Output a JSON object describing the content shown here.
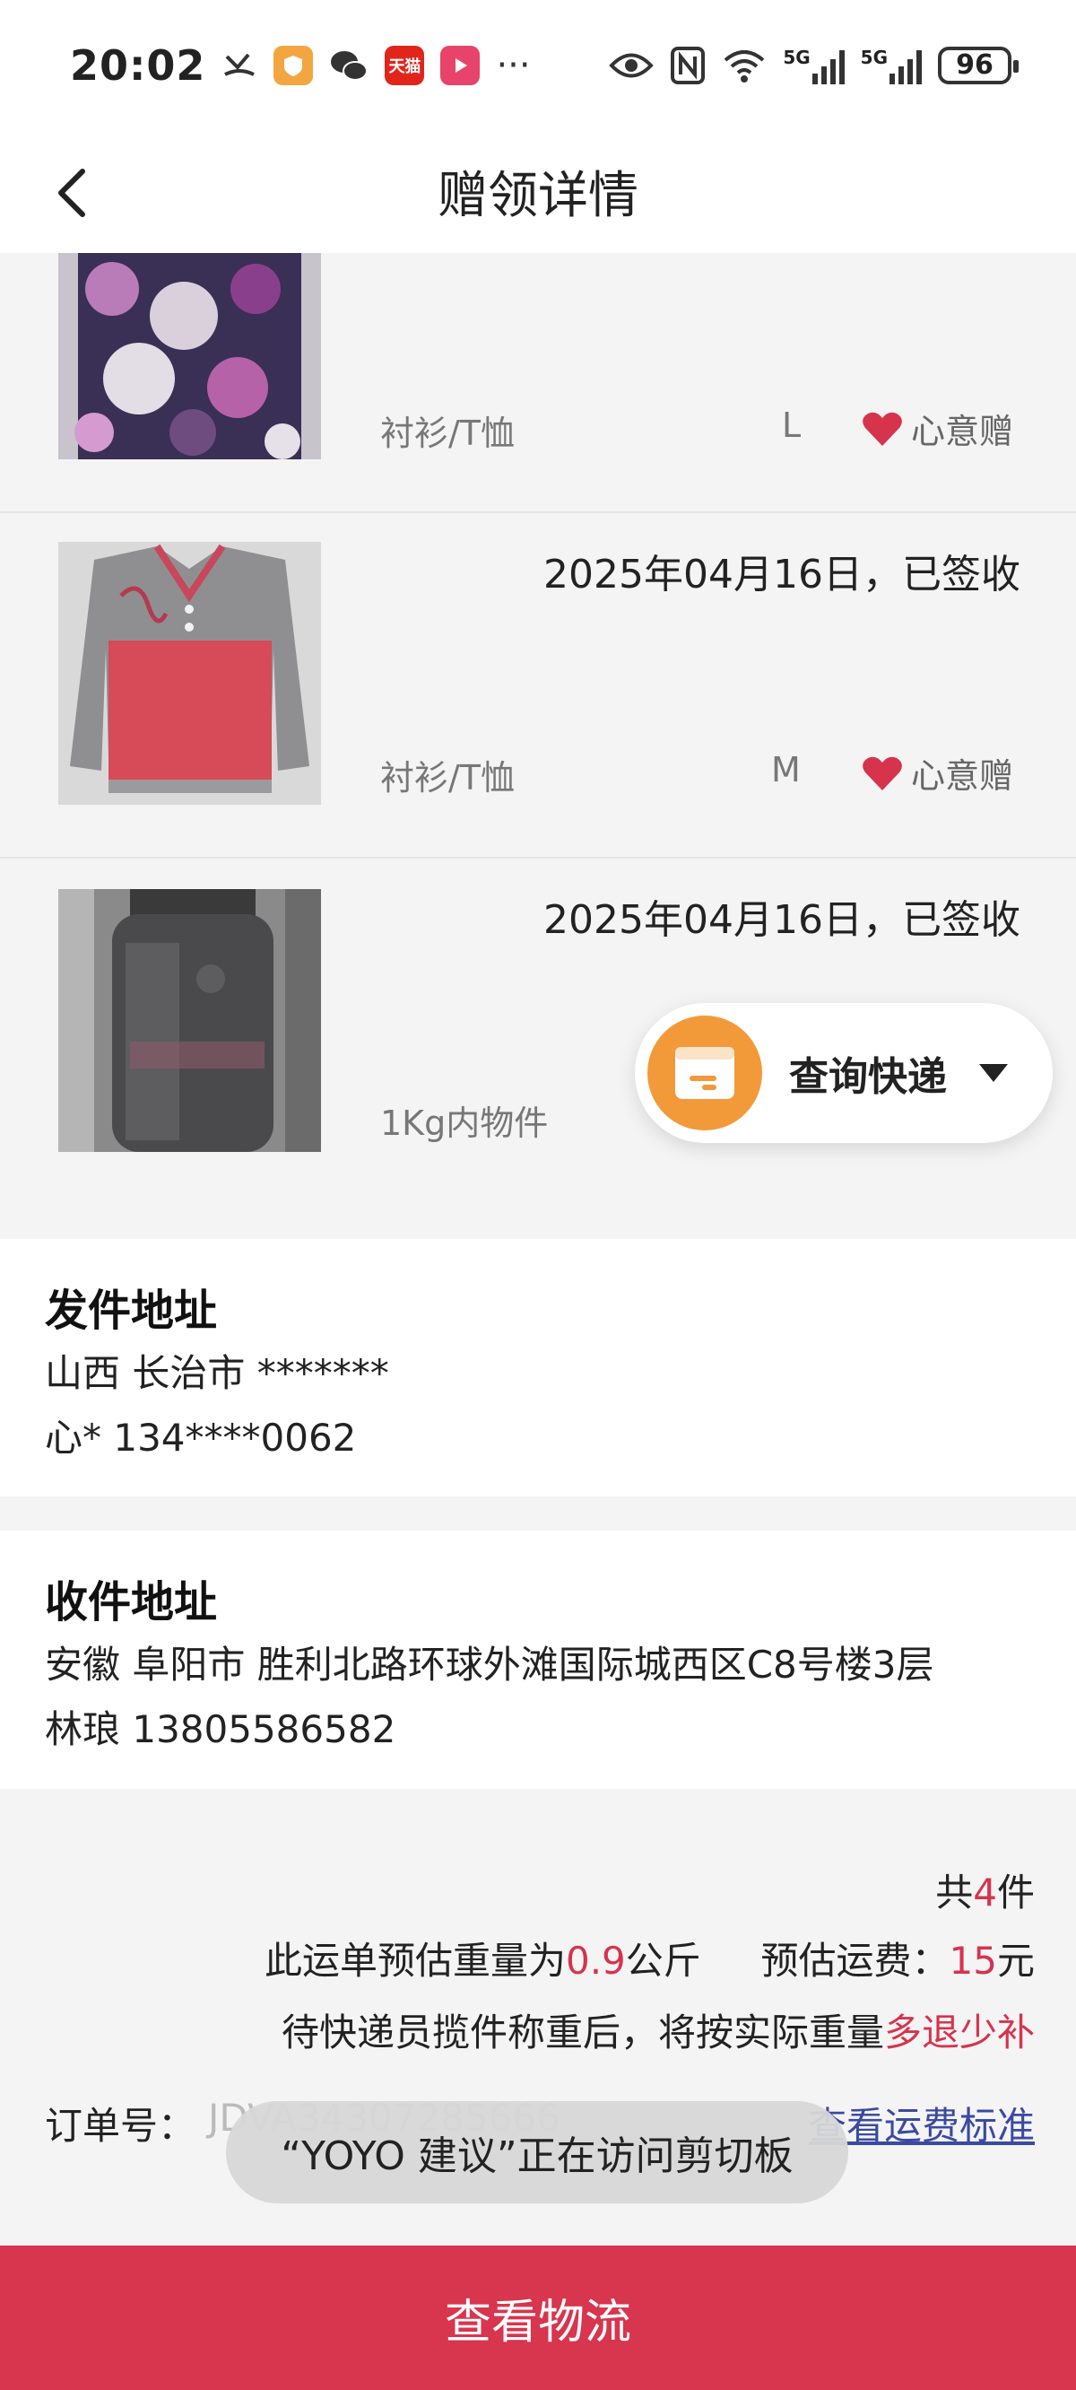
{
  "status_bar": {
    "time": "20:02",
    "network_1": "5G",
    "network_2": "5G",
    "battery": "96",
    "tmall_badge": "天猫",
    "more": "···"
  },
  "header": {
    "title": "赠领详情"
  },
  "items": [
    {
      "category": "衬衫/T恤",
      "size": "L",
      "tag": "心意赠",
      "date_status": ""
    },
    {
      "date_status": "2025年04月16日，已签收",
      "category": "衬衫/T恤",
      "size": "M",
      "tag": "心意赠"
    },
    {
      "date_status": "2025年04月16日，已签收",
      "category": "1Kg内物件",
      "size": "",
      "tag": ""
    }
  ],
  "fab": {
    "label": "查询快递"
  },
  "sender": {
    "title": "发件地址",
    "address": "山西 长治市 *******",
    "contact": "心* 134****0062"
  },
  "receiver": {
    "title": "收件地址",
    "address": "安徽 阜阳市 胜利北路环球外滩国际城西区C8号楼3层",
    "contact": "林琅 13805586582"
  },
  "summary": {
    "total_prefix": "共",
    "total_count": "4",
    "total_suffix": "件",
    "weight_prefix": "此运单预估重量为",
    "weight_value": "0.9",
    "weight_unit": "公斤",
    "fee_prefix": "预估运费：",
    "fee_value": "15",
    "fee_unit": "元",
    "note_prefix": "待快递员揽件称重后，将按实际重量",
    "note_highlight": "多退少补",
    "order_label": "订单号：",
    "order_value": "JDVA34307285666",
    "fee_link": "查看运费标准"
  },
  "toast": {
    "text": "“YOYO 建议”正在访问剪切板"
  },
  "bottom_button": {
    "label": "查看物流"
  },
  "colors": {
    "accent_red": "#d8354f",
    "fab_orange": "#f29a3a",
    "link_blue": "#3b4aa0"
  }
}
